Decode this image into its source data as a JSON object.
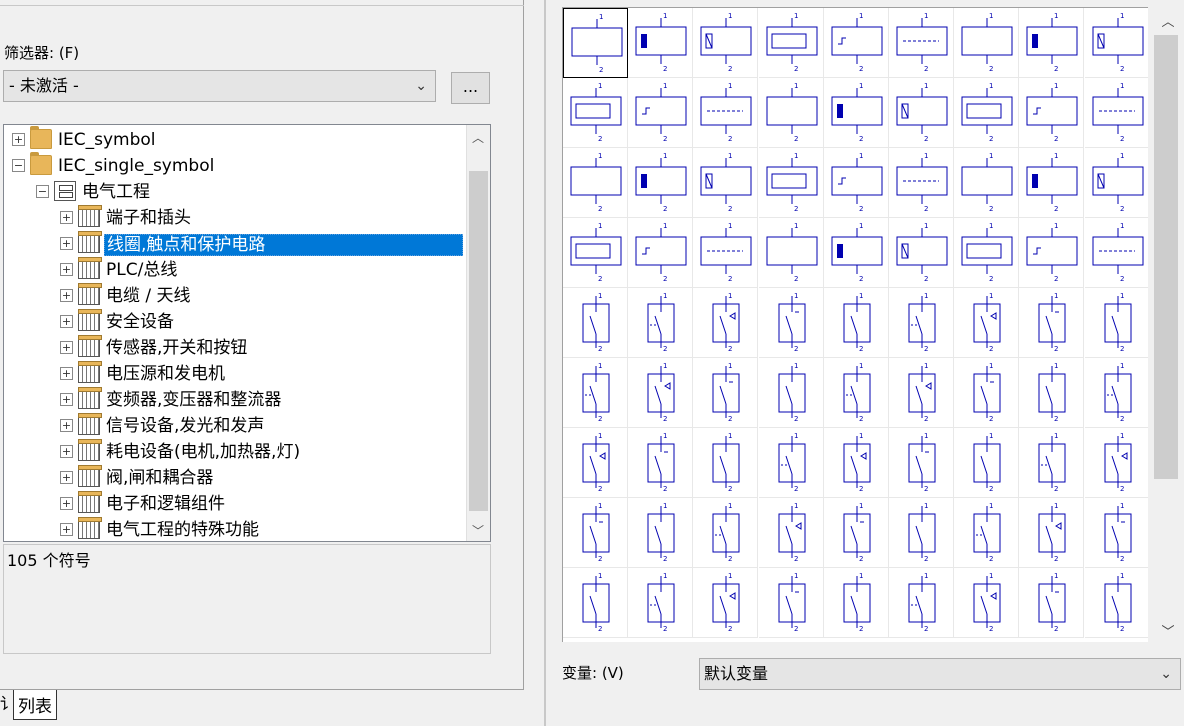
{
  "filter": {
    "label": "筛选器: (F)",
    "selected": "- 未激活 -",
    "more_label": "..."
  },
  "tree": {
    "nodes": [
      {
        "label": "IEC_symbol",
        "level": 0,
        "expander": "+",
        "icon": "folder-icon"
      },
      {
        "label": "IEC_single_symbol",
        "level": 0,
        "expander": "−",
        "icon": "folder-icon"
      },
      {
        "label": "电气工程",
        "level": 1,
        "expander": "−",
        "icon": "lib-icon"
      },
      {
        "label": "端子和插头",
        "level": 2,
        "expander": "+",
        "icon": "cab-icon"
      },
      {
        "label": "线圈,触点和保护电路",
        "level": 2,
        "expander": "+",
        "icon": "cab-icon",
        "selected": true
      },
      {
        "label": "PLC/总线",
        "level": 2,
        "expander": "+",
        "icon": "cab-icon"
      },
      {
        "label": "电缆 / 天线",
        "level": 2,
        "expander": "+",
        "icon": "cab-icon"
      },
      {
        "label": "安全设备",
        "level": 2,
        "expander": "+",
        "icon": "cab-icon"
      },
      {
        "label": "传感器,开关和按钮",
        "level": 2,
        "expander": "+",
        "icon": "cab-icon"
      },
      {
        "label": "电压源和发电机",
        "level": 2,
        "expander": "+",
        "icon": "cab-icon"
      },
      {
        "label": "变频器,变压器和整流器",
        "level": 2,
        "expander": "+",
        "icon": "cab-icon"
      },
      {
        "label": "信号设备,发光和发声",
        "level": 2,
        "expander": "+",
        "icon": "cab-icon"
      },
      {
        "label": "耗电设备(电机,加热器,灯)",
        "level": 2,
        "expander": "+",
        "icon": "cab-icon"
      },
      {
        "label": "阀,闸和耦合器",
        "level": 2,
        "expander": "+",
        "icon": "cab-icon"
      },
      {
        "label": "电子和逻辑组件",
        "level": 2,
        "expander": "+",
        "icon": "cab-icon"
      },
      {
        "label": "电气工程的特殊功能",
        "level": 2,
        "expander": "+",
        "icon": "cab-icon"
      }
    ]
  },
  "symbol_count": "105 个符号",
  "tabs": {
    "partial_label": "讠",
    "list_label": "列表"
  },
  "symbols": {
    "pin_top": "1",
    "pin_bottom": "2",
    "rows": 9,
    "cols": 9
  },
  "variant": {
    "label": "变量: (V)",
    "selected": "默认变量"
  },
  "colors": {
    "symbol_blue": "#0000b0",
    "selection_blue": "#0078d7"
  }
}
